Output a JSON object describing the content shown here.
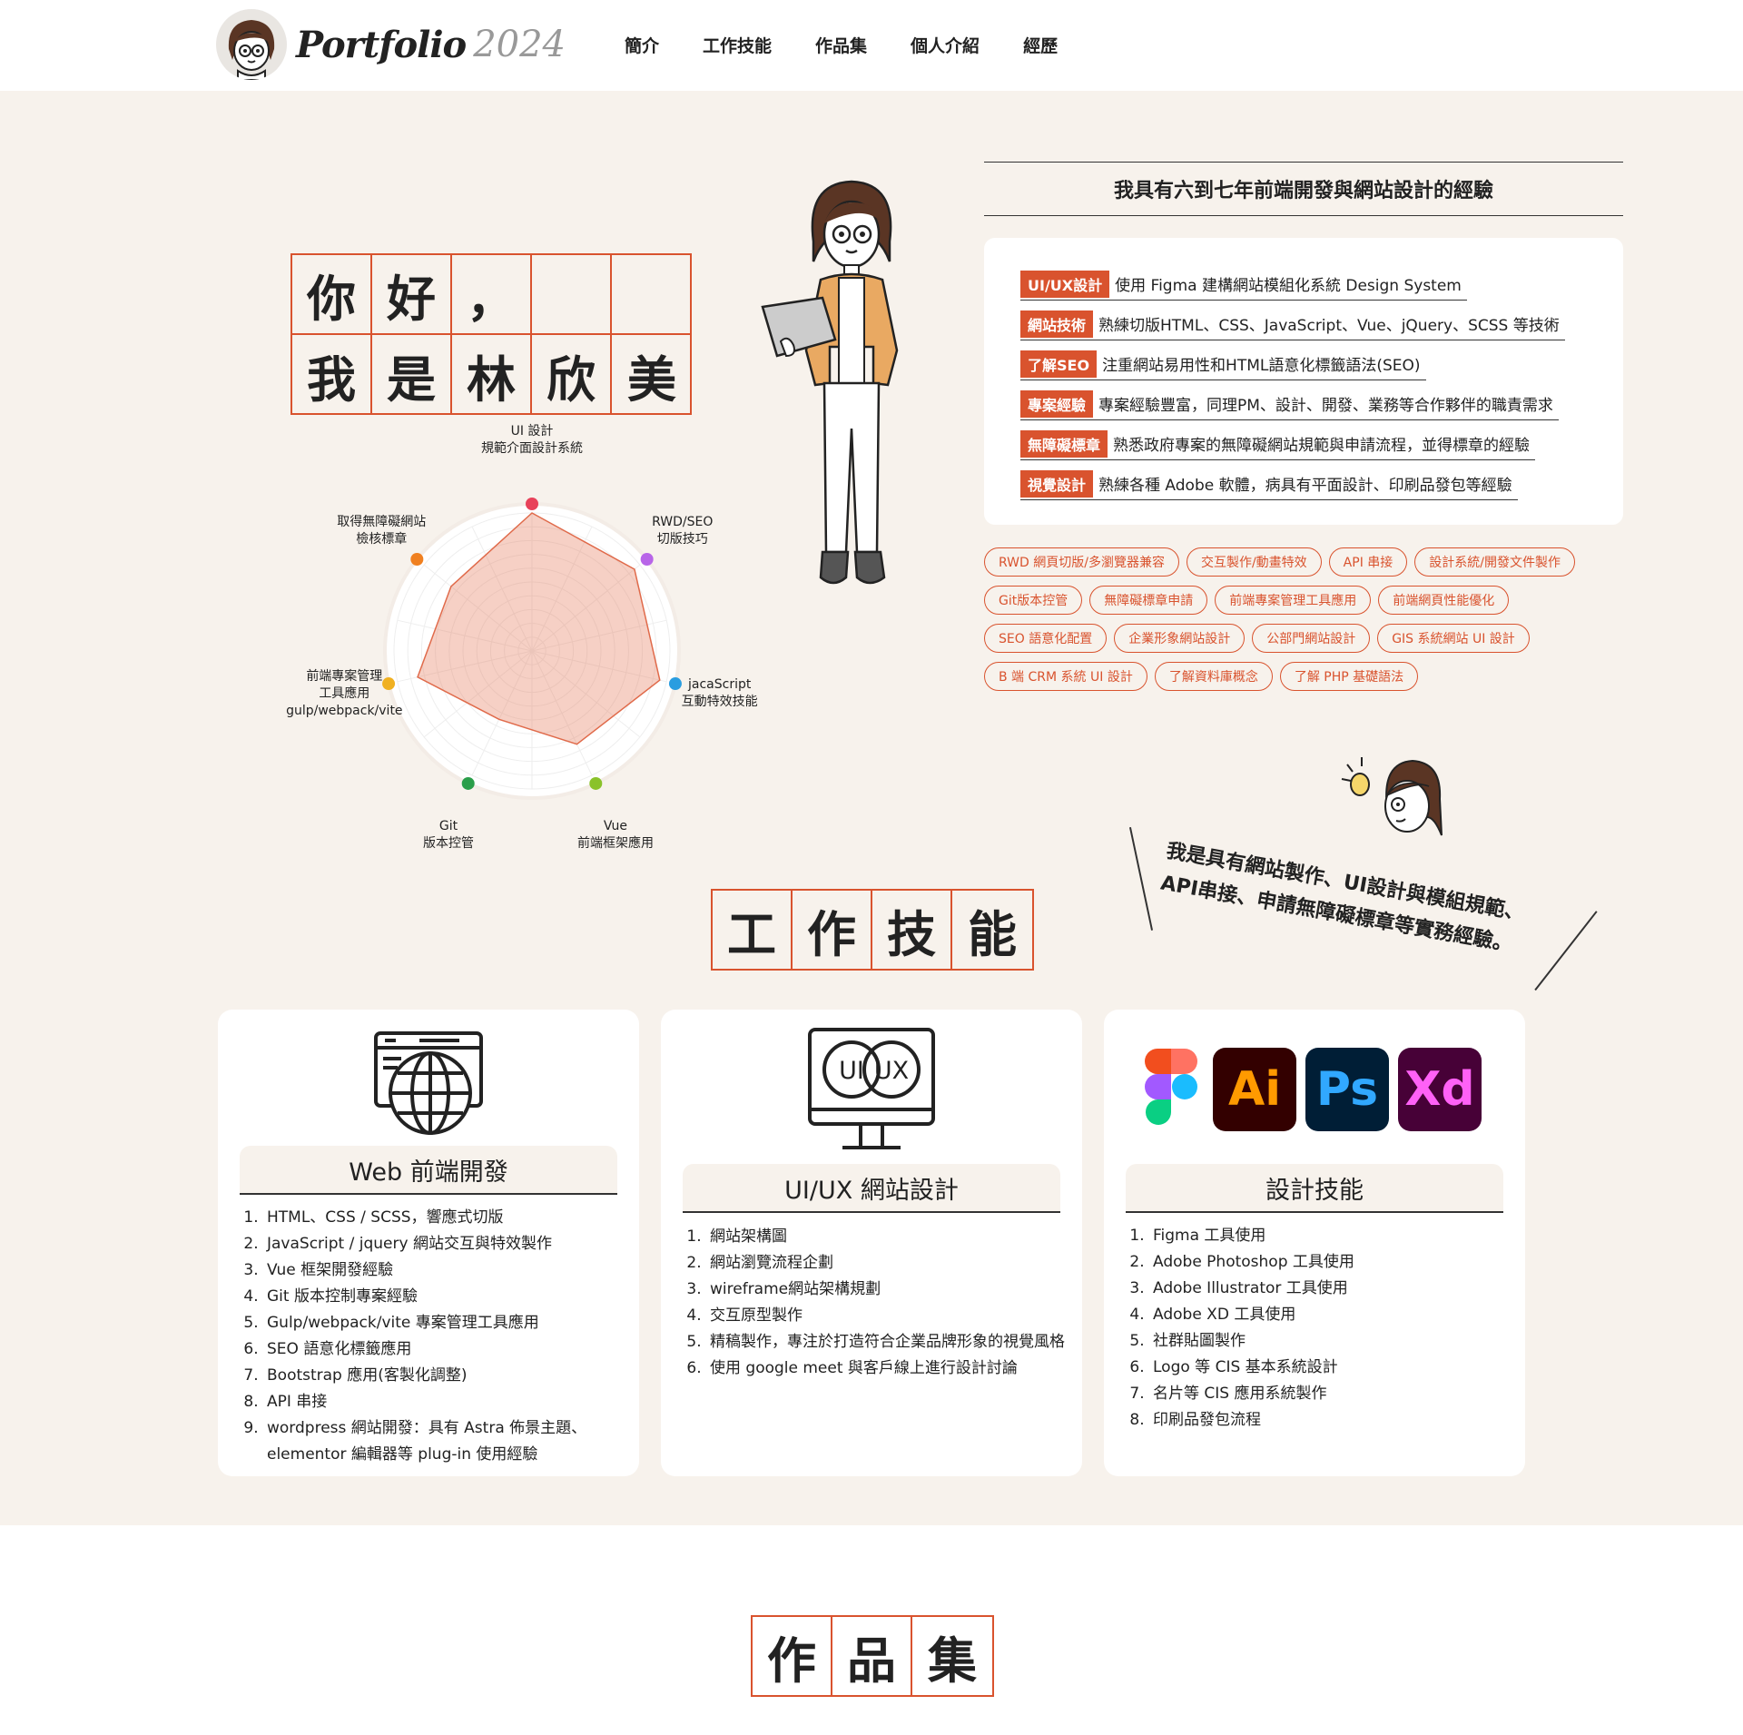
{
  "header": {
    "logo_word": "Portfolio",
    "logo_year": "2024",
    "nav": [
      "簡介",
      "工作技能",
      "作品集",
      "個人介紹",
      "經歷"
    ]
  },
  "hello": {
    "cells": [
      "你",
      "好",
      "，",
      "",
      "",
      "我",
      "是",
      "林",
      "欣",
      "美"
    ]
  },
  "radar": {
    "labels": [
      {
        "line1": "UI 設計",
        "line2": "規範介面設計系統"
      },
      {
        "line1": "RWD/SEO",
        "line2": "切版技巧"
      },
      {
        "line1": "jacaScript",
        "line2": "互動特效技能"
      },
      {
        "line1": "Vue",
        "line2": "前端框架應用"
      },
      {
        "line1": "Git",
        "line2": "版本控管"
      },
      {
        "line1": "前端專案管理",
        "line2": "工具應用",
        "line3": "gulp/webpack/vite"
      },
      {
        "line1": "取得無障礙網站",
        "line2": "檢核標章"
      }
    ],
    "values": [
      1.0,
      0.95,
      0.95,
      0.75,
      0.55,
      0.85,
      0.75
    ],
    "colors": [
      "#e8425a",
      "#b865e8",
      "#2a9de0",
      "#8ac22a",
      "#2a9e4a",
      "#f0b020",
      "#f08020"
    ]
  },
  "experience": {
    "title": "我具有六到七年前端開發與網站設計的經驗",
    "rows": [
      {
        "tag": "UI/UX設計",
        "text": "使用 Figma 建構網站模組化系統 Design System"
      },
      {
        "tag": "網站技術",
        "text": "熟練切版HTML、CSS、JavaScript、Vue、jQuery、SCSS 等技術"
      },
      {
        "tag": "了解SEO",
        "text": "注重網站易用性和HTML語意化標籤語法(SEO)"
      },
      {
        "tag": "專案經驗",
        "text": "專案經驗豐富，同理PM、設計、開發、業務等合作夥伴的職責需求"
      },
      {
        "tag": "無障礙標章",
        "text": "熟悉政府專案的無障礙網站規範與申請流程，並得標章的經驗"
      },
      {
        "tag": "視覺設計",
        "text": "熟練各種 Adobe 軟體，病具有平面設計、印刷品發包等經驗"
      }
    ]
  },
  "pills": [
    "RWD 網頁切版/多瀏覽器兼容",
    "交互製作/動畫特效",
    "API 串接",
    "設計系統/開發文件製作",
    "Git版本控管",
    "無障礙標章申請",
    "前端專案管理工具應用",
    "前端網頁性能優化",
    "SEO 語意化配置",
    "企業形象網站設計",
    "公部門網站設計",
    "GIS 系統網站 UI 設計",
    "B 端 CRM 系統 UI 設計",
    "了解資料庫概念",
    "了解 PHP 基礎語法"
  ],
  "quote": {
    "line1": "我是具有網站製作、UI設計與模組規範、",
    "line2": "API串接、申請無障礙標章等實務經驗。"
  },
  "skills_title": [
    "工",
    "作",
    "技",
    "能"
  ],
  "cards": [
    {
      "title": "Web 前端開發",
      "items": [
        "HTML、CSS / SCSS，響應式切版",
        "JavaScript / jquery 網站交互與特效製作",
        "Vue 框架開發經驗",
        "Git 版本控制專案經驗",
        "Gulp/webpack/vite 專案管理工具應用",
        "SEO 語意化標籤應用",
        "Bootstrap 應用(客製化調整)",
        "API 串接",
        "wordpress 網站開發：具有 Astra 佈景主題、elementor 編輯器等 plug-in 使用經驗"
      ]
    },
    {
      "title": "UI/UX 網站設計",
      "icon_text": [
        "UI",
        "UX"
      ],
      "items": [
        "網站架構圖",
        "網站瀏覽流程企劃",
        "wireframe網站架構規劃",
        "交互原型製作",
        "精稿製作，專注於打造符合企業品牌形象的視覺風格",
        "使用 google meet 與客戶線上進行設計討論"
      ]
    },
    {
      "title": "設計技能",
      "apps": [
        {
          "label": "Ai",
          "bg": "#330000",
          "fg": "#ff9a00"
        },
        {
          "label": "Ps",
          "bg": "#001e36",
          "fg": "#31a8ff"
        },
        {
          "label": "Xd",
          "bg": "#470137",
          "fg": "#ff61f6"
        }
      ],
      "items": [
        "Figma 工具使用",
        "Adobe Photoshop 工具使用",
        "Adobe Illustrator 工具使用",
        "Adobe XD 工具使用",
        "社群貼圖製作",
        "Logo 等 CIS 基本系統設計",
        "名片等 CIS 應用系統製作",
        "印刷品發包流程"
      ]
    }
  ],
  "works_title": [
    "作",
    "品",
    "集"
  ],
  "colors": {
    "accent": "#d9532e",
    "beige": "#f7f2ec"
  }
}
